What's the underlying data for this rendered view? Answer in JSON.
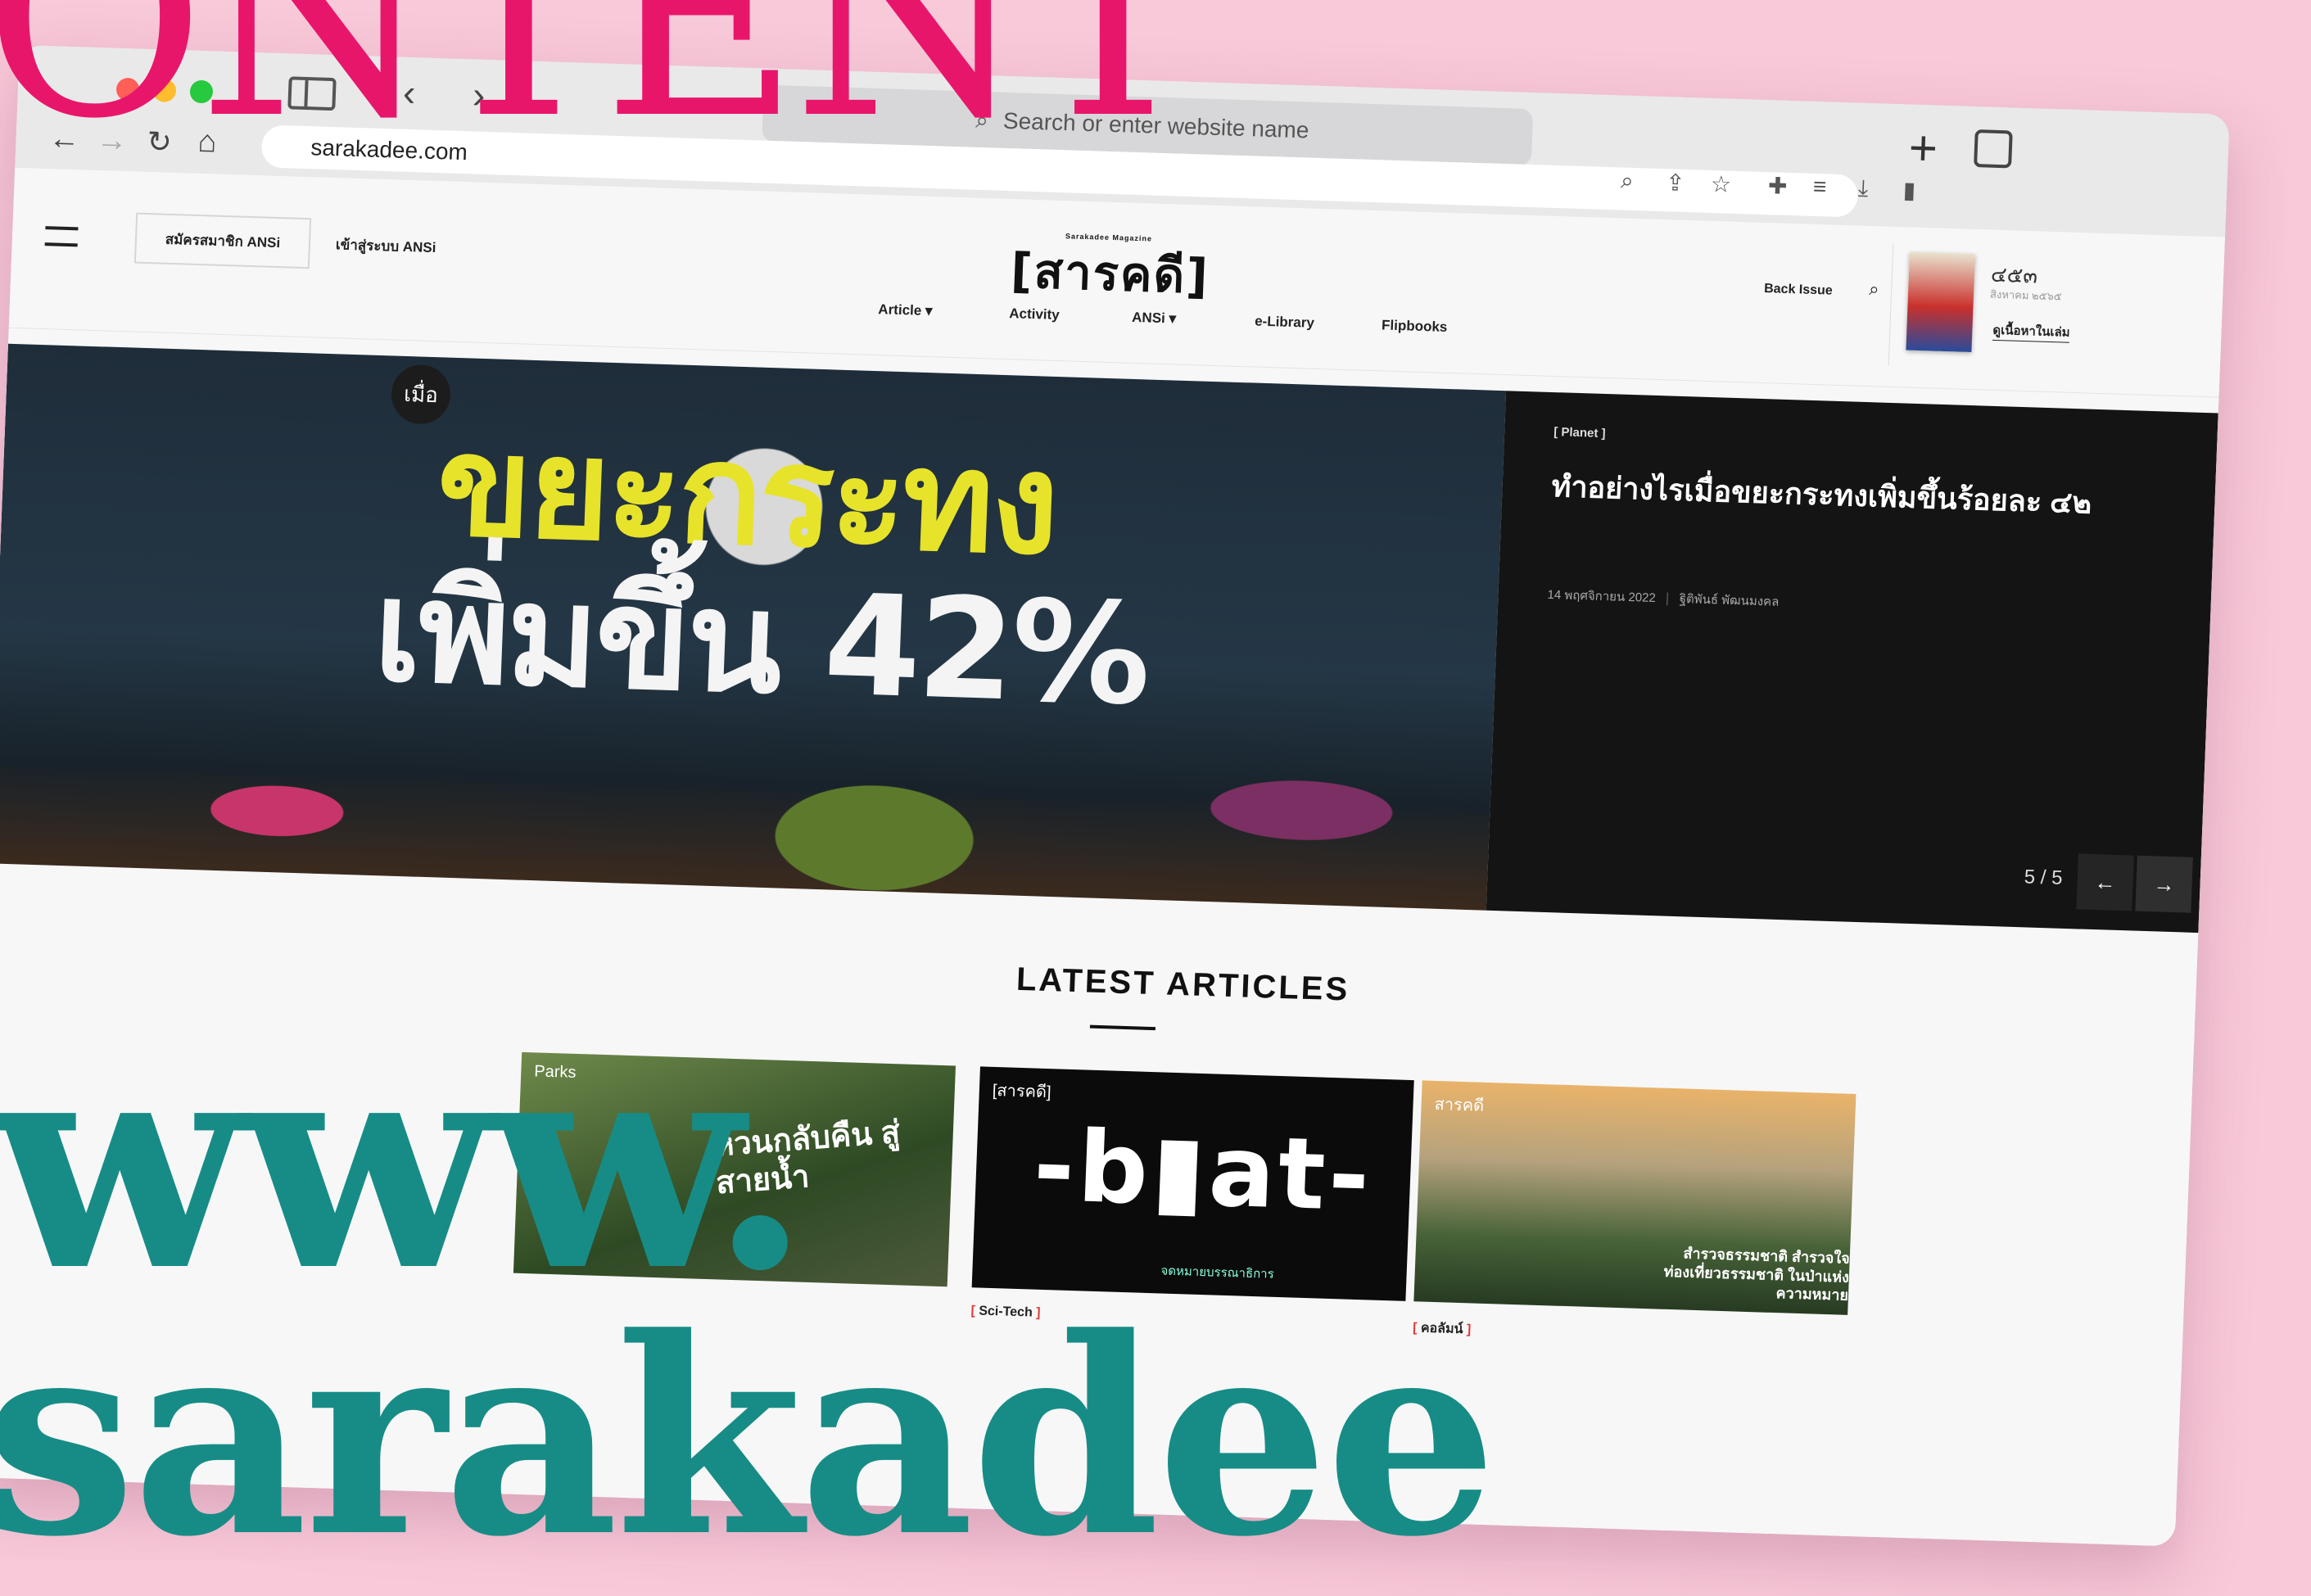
{
  "background": {
    "top_word": "ONTENT",
    "middle_word": "www.",
    "bottom_word": "sarakadee"
  },
  "browser": {
    "search_placeholder": "Search or enter website name",
    "url": "sarakadee.com",
    "icons": [
      "sidebar-icon",
      "back-chevron-icon",
      "forward-chevron-icon",
      "search-icon",
      "new-tab-icon",
      "tabs-overview-icon",
      "back-arrow-icon",
      "forward-arrow-icon",
      "reload-icon",
      "home-icon",
      "zoom-icon",
      "share-icon",
      "star-icon",
      "extension-icon",
      "reading-list-icon",
      "download-icon",
      "sidebar-right-icon"
    ]
  },
  "header": {
    "register_label": "สมัครสมาชิก ANSi",
    "login_label": "เข้าสู่ระบบ ANSi",
    "logo_text": "[สารคดี]",
    "logo_sub": "Sarakadee Magazine",
    "back_issue_label": "Back Issue",
    "issue_number": "๔๕๓",
    "issue_date": "สิงหาคม ๒๕๖๕",
    "issue_link": "ดูเนื้อหาในเล่ม"
  },
  "nav": {
    "items": [
      {
        "label": "Article",
        "has_dropdown": true
      },
      {
        "label": "Activity",
        "has_dropdown": false
      },
      {
        "label": "ANSi",
        "has_dropdown": true
      },
      {
        "label": "e-Library",
        "has_dropdown": false
      },
      {
        "label": "Flipbooks",
        "has_dropdown": false
      }
    ],
    "dropdown_glyph": "▾"
  },
  "hero": {
    "image_prefix": "เมื่อ",
    "image_line1": "ขยะกระทง",
    "image_line2": "เพิ่มขึ้น 42%",
    "category": "Planet",
    "title": "ทำอย่างไรเมื่อขยะกระทงเพิ่มขึ้นร้อยละ ๔๒",
    "date": "14 พฤศจิกายน 2022",
    "author": "ฐิติพันธ์ พัฒนมงคล",
    "counter": "5 / 5",
    "prev_glyph": "←",
    "next_glyph": "→"
  },
  "latest": {
    "heading": "LATEST ARTICLES",
    "cards": [
      {
        "brand": "Parks",
        "overlay": "หวนกลับคืน สู่สายน้ำ",
        "category": ""
      },
      {
        "brand": "[สารคดี]",
        "overlay": "-b▮at-",
        "sub": "จดหมายบรรณาธิการ",
        "category": "Sci-Tech"
      },
      {
        "brand": "สารคดี",
        "overlay": "สำรวจธรรมชาติ สำรวจใจ ท่องเที่ยวธรรมชาติ ในป่าแห่งความหมาย",
        "category": "คอลัมน์"
      }
    ]
  },
  "colors": {
    "background": "#f8c9d9",
    "magenta": "#e8166a",
    "teal": "#178c86",
    "hero_panel": "#141414",
    "accent_red": "#e03a3a"
  }
}
